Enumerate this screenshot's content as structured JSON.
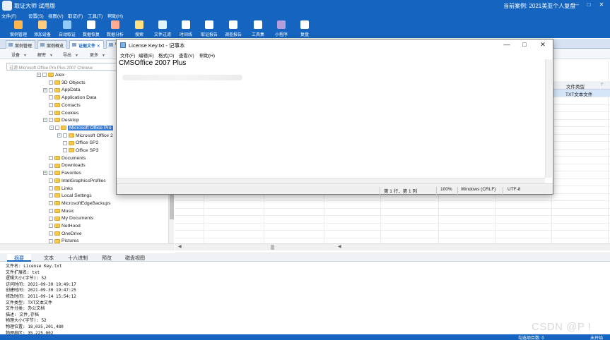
{
  "app": {
    "title": "取证大师 试用版",
    "current_case": "当前案例: 2021美亚个人复盘",
    "window_buttons": [
      "—",
      "□",
      "✕"
    ]
  },
  "menu": [
    "文件(F)",
    "设置(S)",
    "视图(V)",
    "取证(F)",
    "工具(T)",
    "帮助(H)"
  ],
  "ribbon": [
    {
      "label": "案例管理",
      "icon": "case-icon",
      "color": "#ffb74d"
    },
    {
      "label": "添加设备",
      "icon": "add-device-icon",
      "color": "#ffcc80"
    },
    {
      "label": "自动取证",
      "icon": "auto-forensic-icon",
      "color": "#90caf9"
    },
    {
      "label": "数据恢复",
      "icon": "recover-icon",
      "color": "#ffffff"
    },
    {
      "label": "数据分析",
      "icon": "analysis-icon",
      "color": "#ffab91"
    },
    {
      "label": "搜索",
      "icon": "search-icon",
      "color": "#ffe082"
    },
    {
      "label": "文件过滤",
      "icon": "filter-icon",
      "color": "#e1f5fe"
    },
    {
      "label": "时间线",
      "icon": "timeline-icon",
      "color": "#ffffff"
    },
    {
      "label": "取证报告",
      "icon": "report-icon",
      "color": "#ffffff"
    },
    {
      "label": "调查报告",
      "icon": "survey-report-icon",
      "color": "#ffffff"
    },
    {
      "label": "工具集",
      "icon": "toolset-icon",
      "color": "#ffffff"
    },
    {
      "label": "小程序",
      "icon": "miniprogram-icon",
      "color": "#b39ddb"
    },
    {
      "label": "复盘",
      "icon": "review-icon",
      "color": "#ffffff"
    }
  ],
  "tabs": [
    {
      "label": "案例管理",
      "active": false
    },
    {
      "label": "案例概览",
      "active": false
    },
    {
      "label": "证据文件",
      "active": true,
      "closable": "✕"
    },
    {
      "label": "C",
      "active": false
    }
  ],
  "toolbar": [
    "设备",
    "解密",
    "导出",
    "更多"
  ],
  "search": {
    "value": "过滤 Microsoft Office Pro Plus 2007 Chinese"
  },
  "tree": [
    {
      "label": "Alex",
      "level": 0,
      "exp": "−"
    },
    {
      "label": "3D Objects",
      "level": 1,
      "exp": ""
    },
    {
      "label": "AppData",
      "level": 1,
      "exp": "+"
    },
    {
      "label": "Application Data",
      "level": 1,
      "exp": ""
    },
    {
      "label": "Contacts",
      "level": 1,
      "exp": ""
    },
    {
      "label": "Cookies",
      "level": 1,
      "exp": ""
    },
    {
      "label": "Desktop",
      "level": 1,
      "exp": "−"
    },
    {
      "label": "Microsoft Office Pro",
      "level": 2,
      "exp": "−",
      "selected": true
    },
    {
      "label": "Microsoft Office 2",
      "level": 3,
      "exp": "+"
    },
    {
      "label": "Office SP2",
      "level": 3,
      "exp": ""
    },
    {
      "label": "Office SP3",
      "level": 3,
      "exp": ""
    },
    {
      "label": "Documents",
      "level": 1,
      "exp": ""
    },
    {
      "label": "Downloads",
      "level": 1,
      "exp": ""
    },
    {
      "label": "Favorites",
      "level": 1,
      "exp": "+"
    },
    {
      "label": "IntelGraphicsProfiles",
      "level": 1,
      "exp": ""
    },
    {
      "label": "Links",
      "level": 1,
      "exp": ""
    },
    {
      "label": "Local Settings",
      "level": 1,
      "exp": ""
    },
    {
      "label": "MicrosoftEdgeBackups",
      "level": 1,
      "exp": ""
    },
    {
      "label": "Music",
      "level": 1,
      "exp": ""
    },
    {
      "label": "My Documents",
      "level": 1,
      "exp": ""
    },
    {
      "label": "NetHood",
      "level": 1,
      "exp": ""
    },
    {
      "label": "OneDrive",
      "level": 1,
      "exp": ""
    },
    {
      "label": "Pictures",
      "level": 1,
      "exp": ""
    }
  ],
  "grid": {
    "columns": [
      "文件类型"
    ],
    "selected_row": {
      "file_type": "TXT文本文件"
    }
  },
  "bottom_tabs": [
    "摘要",
    "文本",
    "十六进制",
    "预览",
    "磁盘视图"
  ],
  "summary": [
    "文件名: License Key.txt",
    "文件扩展名: txt",
    "逻辑大小(字节): 52",
    "访问时间: 2021-09-30 19:49:17",
    "创建时间: 2021-09-30 19:47:25",
    "修改时间: 2011-09-14 15:54:12",
    "文件类型: TXT文本文件",
    "文件分类: 办公文档",
    "描述: 文件,存档",
    "物理大小(字节): 52",
    "物理位置: 18,035,201,480",
    "物理扇区: 35,225,002"
  ],
  "status": {
    "label": "勾选项目数: 0",
    "label2": "未开始",
    "watermark": "CSDN @P !"
  },
  "notepad": {
    "title": "License Key.txt - 记事本",
    "menu": [
      "文件(F)",
      "编辑(E)",
      "格式(O)",
      "查看(V)",
      "帮助(H)"
    ],
    "content": "CMSOffice 2007 Plus",
    "status": {
      "position": "第 1 行，第 1 列",
      "zoom": "100%",
      "line_ending": "Windows (CRLF)",
      "encoding": "UTF-8"
    },
    "buttons": [
      "—",
      "□",
      "✕"
    ]
  }
}
